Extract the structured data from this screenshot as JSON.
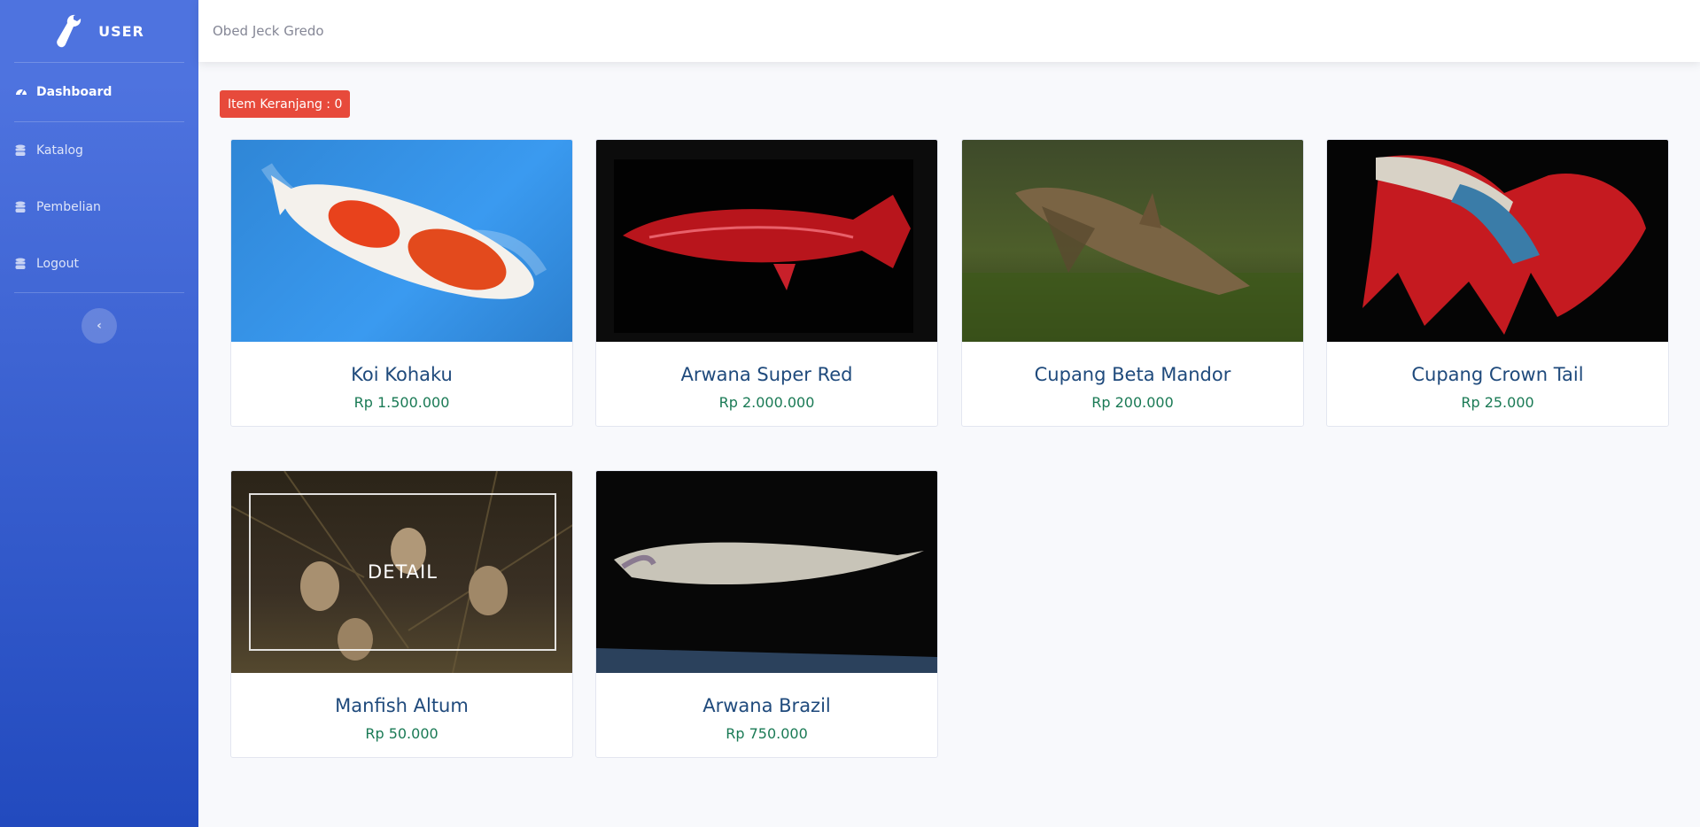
{
  "sidebar": {
    "brand": "USER",
    "items": [
      {
        "label": "Dashboard",
        "icon": "tachometer-icon",
        "active": true
      },
      {
        "label": "Katalog",
        "icon": "database-icon"
      },
      {
        "label": "Pembelian",
        "icon": "database-icon"
      },
      {
        "label": "Logout",
        "icon": "database-icon"
      }
    ],
    "toggle_icon": "chevron-left-icon"
  },
  "topbar": {
    "user_name": "Obed Jeck Gredo"
  },
  "cart_badge": "Item Keranjang : 0",
  "products": [
    {
      "name": "Koi Kohaku",
      "price": "Rp 1.500.000"
    },
    {
      "name": "Arwana Super Red",
      "price": "Rp 2.000.000"
    },
    {
      "name": "Cupang Beta Mandor",
      "price": "Rp 200.000"
    },
    {
      "name": "Cupang Crown Tail",
      "price": "Rp 25.000"
    },
    {
      "name": "Manfish Altum",
      "price": "Rp 50.000",
      "overlay": "DETAIL"
    },
    {
      "name": "Arwana Brazil",
      "price": "Rp 750.000"
    }
  ],
  "colors": {
    "sidebar_top": "#4e73df",
    "sidebar_bottom": "#224abe",
    "badge": "#e74a3b",
    "title": "#1f4a7c",
    "price": "#1a7a55"
  }
}
